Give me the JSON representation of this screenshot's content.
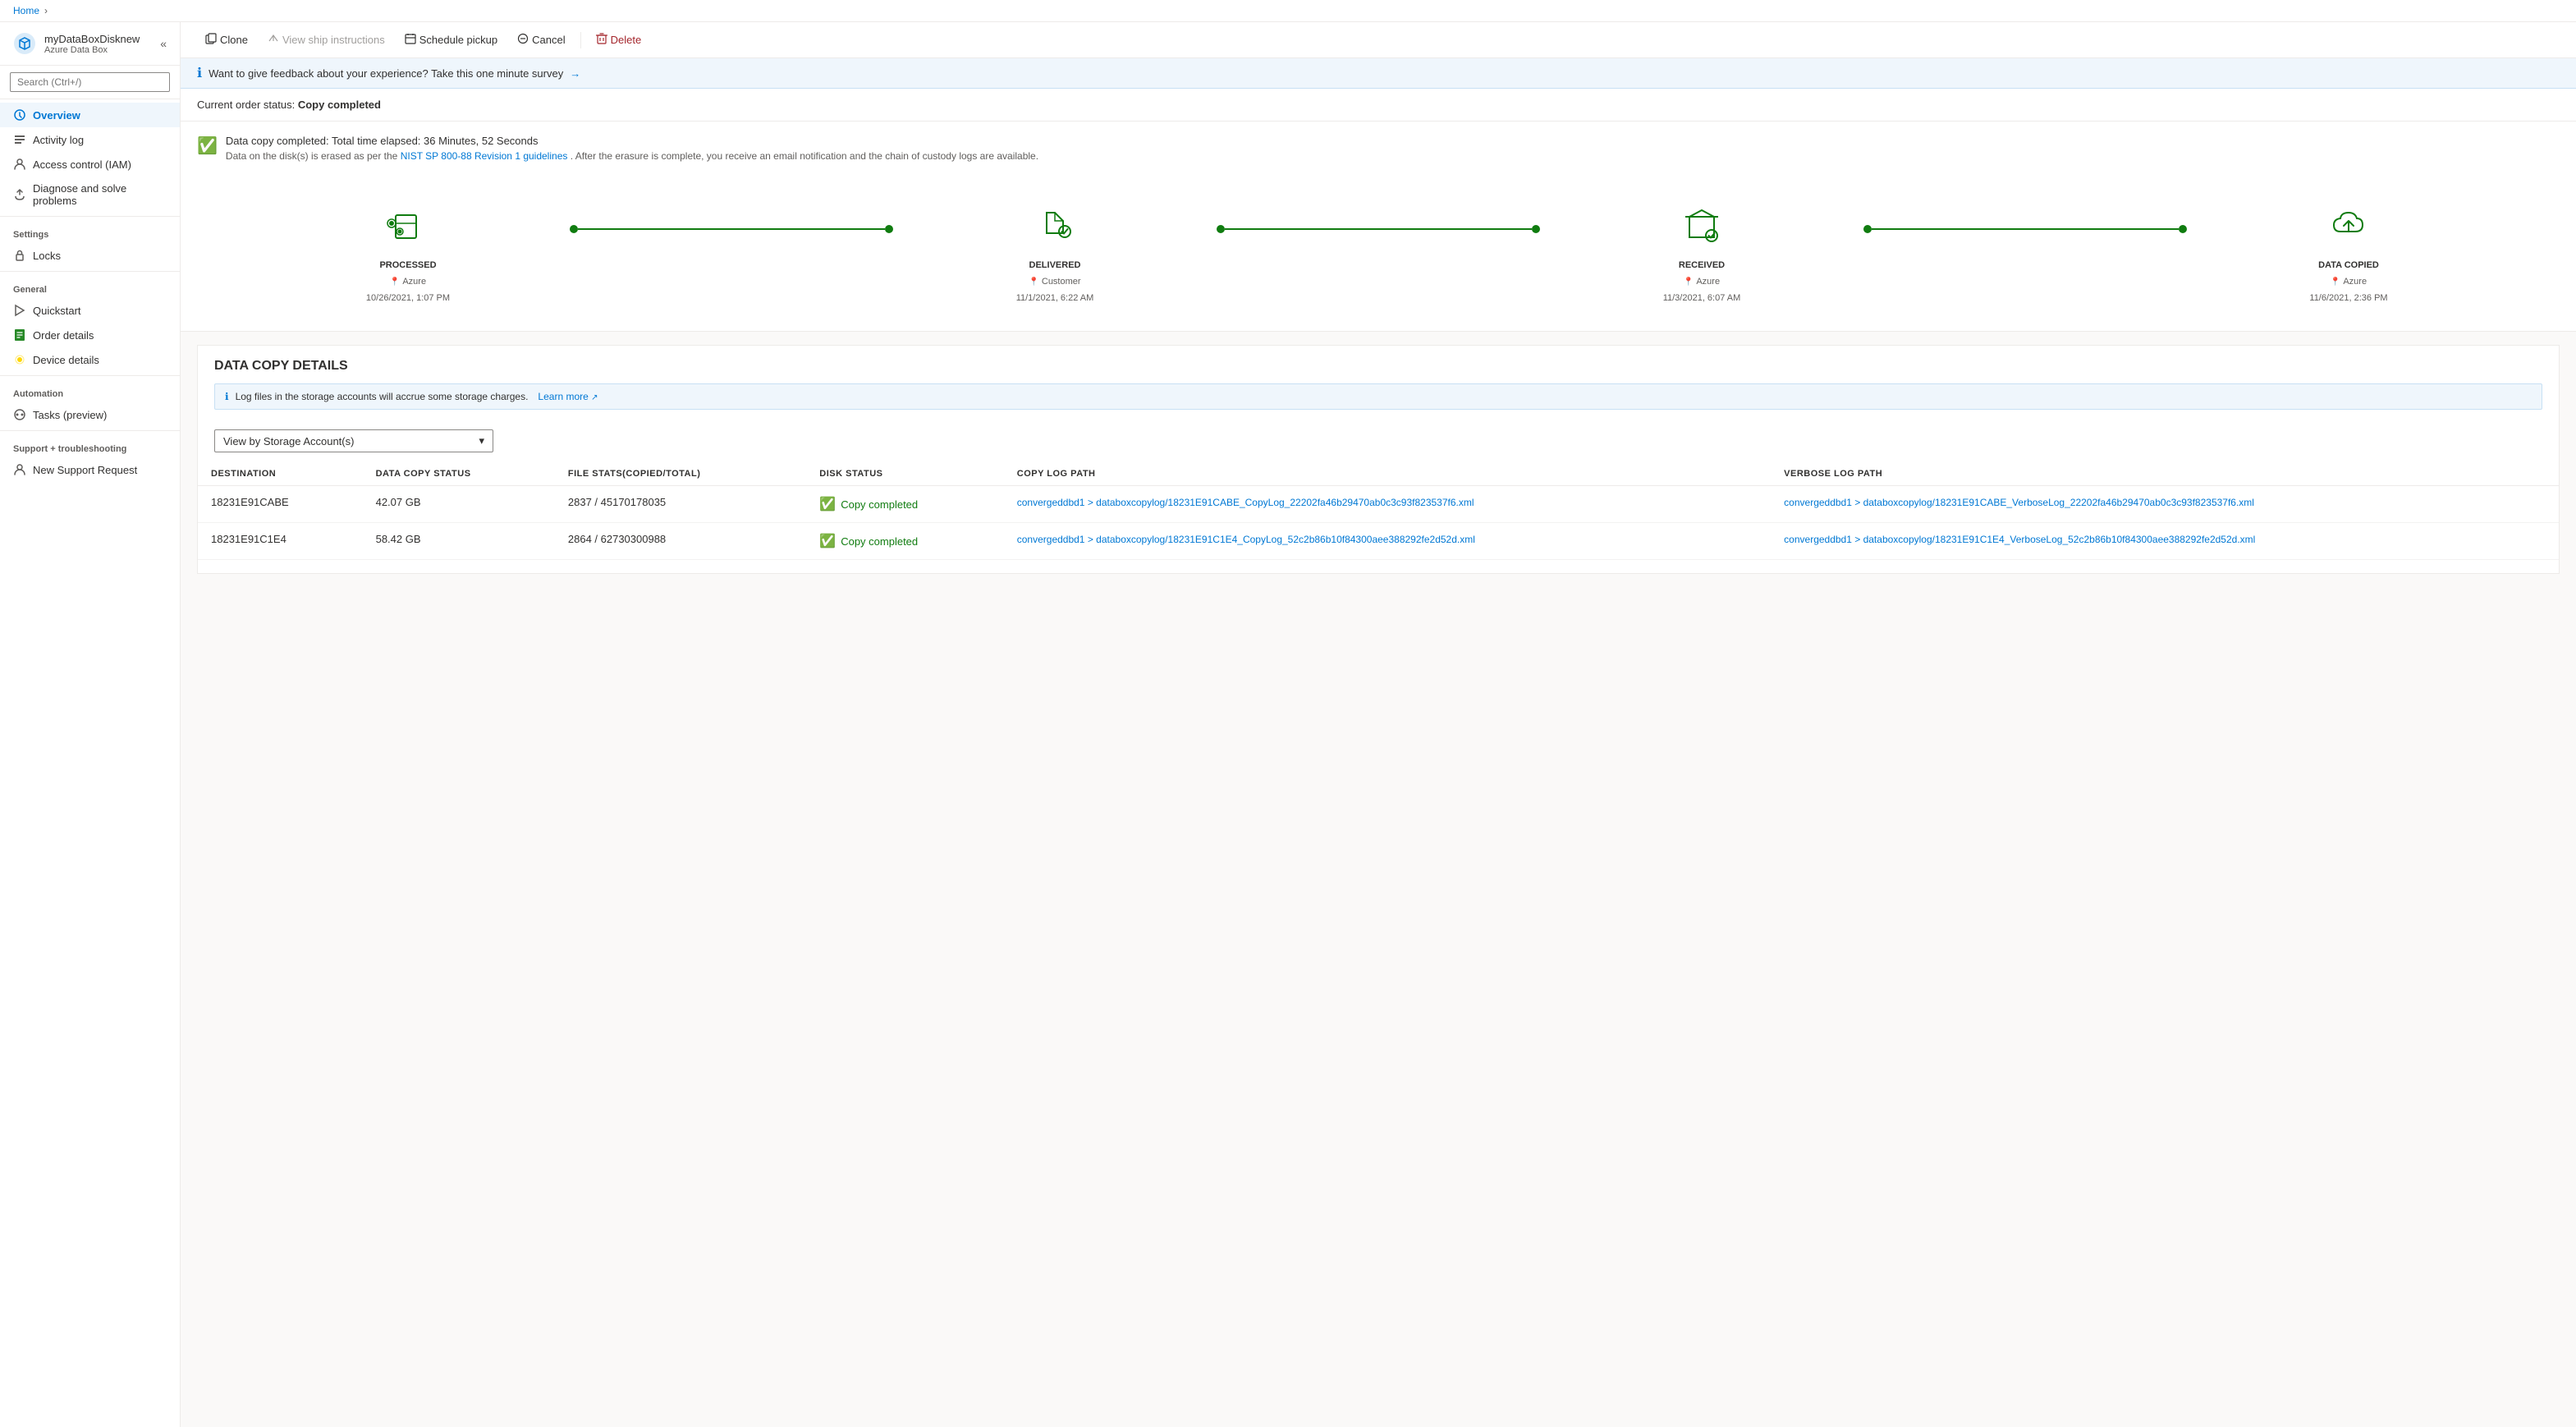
{
  "breadcrumb": {
    "home": "Home",
    "separator": "›"
  },
  "sidebar": {
    "title": "myDataBoxDisknew",
    "subtitle": "Azure Data Box",
    "search_placeholder": "Search (Ctrl+/)",
    "collapse_icon": "«",
    "nav_items": [
      {
        "id": "overview",
        "label": "Overview",
        "icon": "⬡",
        "active": true
      },
      {
        "id": "activity-log",
        "label": "Activity log",
        "icon": "≡",
        "active": false
      },
      {
        "id": "access-control",
        "label": "Access control (IAM)",
        "icon": "👤",
        "active": false
      },
      {
        "id": "diagnose",
        "label": "Diagnose and solve problems",
        "icon": "🔧",
        "active": false
      }
    ],
    "sections": [
      {
        "label": "Settings",
        "items": [
          {
            "id": "locks",
            "label": "Locks",
            "icon": "🔒"
          }
        ]
      },
      {
        "label": "General",
        "items": [
          {
            "id": "quickstart",
            "label": "Quickstart",
            "icon": "⚡"
          },
          {
            "id": "order-details",
            "label": "Order details",
            "icon": "📋"
          },
          {
            "id": "device-details",
            "label": "Device details",
            "icon": "💡"
          }
        ]
      },
      {
        "label": "Automation",
        "items": [
          {
            "id": "tasks",
            "label": "Tasks (preview)",
            "icon": "👥"
          }
        ]
      },
      {
        "label": "Support + troubleshooting",
        "items": [
          {
            "id": "new-support",
            "label": "New Support Request",
            "icon": "👤"
          }
        ]
      }
    ]
  },
  "toolbar": {
    "buttons": [
      {
        "id": "clone",
        "label": "Clone",
        "icon": "⧉",
        "disabled": false
      },
      {
        "id": "view-ship",
        "label": "View ship instructions",
        "icon": "↓",
        "disabled": false
      },
      {
        "id": "schedule-pickup",
        "label": "Schedule pickup",
        "icon": "📅",
        "disabled": false
      },
      {
        "id": "cancel",
        "label": "Cancel",
        "icon": "⊘",
        "disabled": false
      },
      {
        "id": "delete",
        "label": "Delete",
        "icon": "🗑",
        "disabled": false,
        "danger": true
      }
    ]
  },
  "feedback": {
    "text": "Want to give feedback about your experience? Take this one minute survey",
    "arrow": "→"
  },
  "order_status": {
    "label": "Current order status:",
    "value": "Copy completed"
  },
  "copy_message": {
    "main": "Data copy completed: Total time elapsed: 36 Minutes, 52 Seconds",
    "erasure_prefix": "Data on the disk(s) is erased as per the ",
    "nist_link": "NIST SP 800-88 Revision 1 guidelines",
    "erasure_suffix": ". After the erasure is complete, you receive an email notification and the chain of custody logs are available."
  },
  "timeline": {
    "steps": [
      {
        "id": "processed",
        "label": "PROCESSED",
        "location": "Azure",
        "date": "10/26/2021, 1:07 PM"
      },
      {
        "id": "delivered",
        "label": "DELIVERED",
        "location": "Customer",
        "date": "11/1/2021, 6:22 AM"
      },
      {
        "id": "received",
        "label": "RECEIVED",
        "location": "Azure",
        "date": "11/3/2021, 6:07 AM"
      },
      {
        "id": "data-copied",
        "label": "DATA COPIED",
        "location": "Azure",
        "date": "11/6/2021, 2:36 PM"
      }
    ]
  },
  "data_copy": {
    "section_title": "DATA COPY DETAILS",
    "info_text": "Log files in the storage accounts will accrue some storage charges.",
    "learn_more": "Learn more",
    "dropdown_label": "View by Storage Account(s)",
    "table": {
      "columns": [
        "DESTINATION",
        "DATA COPY STATUS",
        "FILE STATS(COPIED/TOTAL)",
        "DISK STATUS",
        "COPY LOG PATH",
        "VERBOSE LOG PATH"
      ],
      "rows": [
        {
          "destination": "18231E91CABE",
          "data_copy_status": "42.07 GB",
          "file_stats": "2837 / 45170178035",
          "disk_status": "Copy completed",
          "copy_log_path": "convergeddbd1 > databoxcopylog/18231E91CABE_CopyLog_22202fa46b29470ab0c3c93f823537f6.xml",
          "verbose_log_path": "convergeddbd1 > databoxcopylog/18231E91CABE_VerboseLog_22202fa46b29470ab0c3c93f823537f6.xml"
        },
        {
          "destination": "18231E91C1E4",
          "data_copy_status": "58.42 GB",
          "file_stats": "2864 / 62730300988",
          "disk_status": "Copy completed",
          "copy_log_path": "convergeddbd1 > databoxcopylog/18231E91C1E4_CopyLog_52c2b86b10f84300aee388292fe2d52d.xml",
          "verbose_log_path": "convergeddbd1 > databoxcopylog/18231E91C1E4_VerboseLog_52c2b86b10f84300aee388292fe2d52d.xml"
        }
      ]
    }
  }
}
